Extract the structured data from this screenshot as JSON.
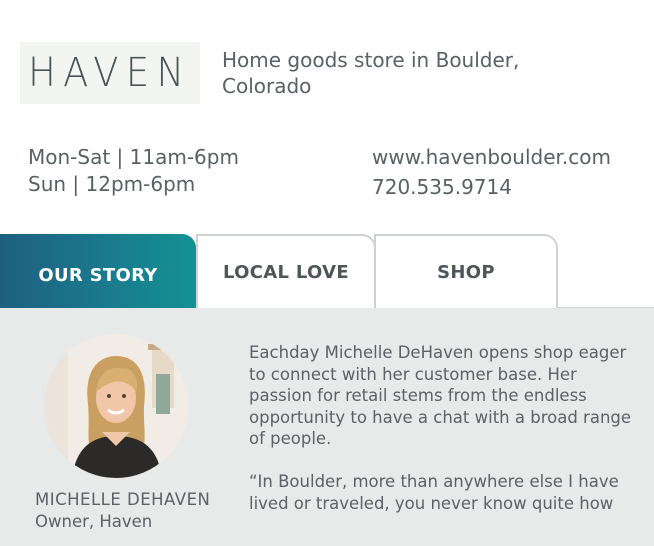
{
  "brand": {
    "logo_text": "HAVEN",
    "tagline": "Home goods store in Boulder, Colorado"
  },
  "hours": {
    "weekday": "Mon-Sat | 11am-6pm",
    "sunday": "Sun | 12pm-6pm"
  },
  "contact": {
    "website": "www.havenboulder.com",
    "phone": "720.535.9714"
  },
  "tabs": [
    {
      "label": "OUR STORY",
      "active": true
    },
    {
      "label": "LOCAL LOVE",
      "active": false
    },
    {
      "label": "SHOP",
      "active": false
    }
  ],
  "story": {
    "owner_name": "MICHELLE DEHAVEN",
    "owner_role": "Owner, Haven",
    "paragraph_1": "Eachday Michelle DeHaven opens shop eager to connect with her customer base. Her passion for retail stems from the endless opportunity to have a chat with a broad range of people.",
    "paragraph_2": "“In Boulder, more than anywhere else I have lived or traveled, you never know quite how"
  },
  "colors": {
    "tab_active_start": "#1e5f80",
    "tab_active_end": "#139292",
    "panel_bg": "#e8e9e9",
    "text": "#5a6066"
  }
}
